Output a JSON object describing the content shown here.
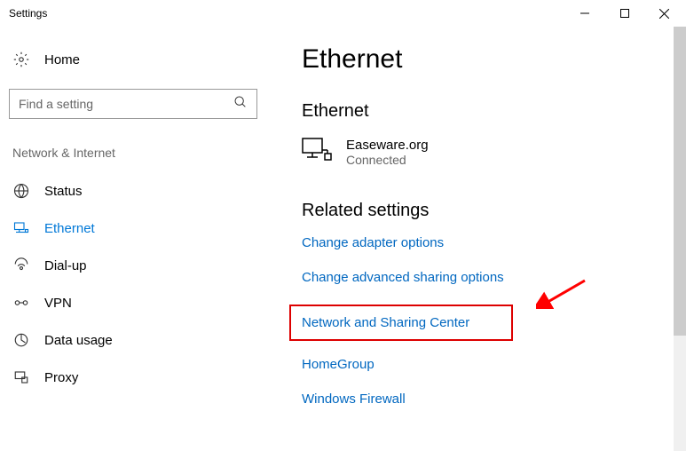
{
  "window": {
    "title": "Settings"
  },
  "sidebar": {
    "home": "Home",
    "search_placeholder": "Find a setting",
    "category": "Network & Internet",
    "items": [
      {
        "label": "Status"
      },
      {
        "label": "Ethernet"
      },
      {
        "label": "Dial-up"
      },
      {
        "label": "VPN"
      },
      {
        "label": "Data usage"
      },
      {
        "label": "Proxy"
      }
    ]
  },
  "main": {
    "title": "Ethernet",
    "subtitle": "Ethernet",
    "connection": {
      "name": "Easeware.org",
      "status": "Connected"
    },
    "related_title": "Related settings",
    "links": [
      "Change adapter options",
      "Change advanced sharing options",
      "Network and Sharing Center",
      "HomeGroup",
      "Windows Firewall"
    ]
  },
  "colors": {
    "accent": "#0078d7",
    "link": "#0067c0",
    "highlight_box": "#d00000",
    "arrow": "#ff0000"
  }
}
